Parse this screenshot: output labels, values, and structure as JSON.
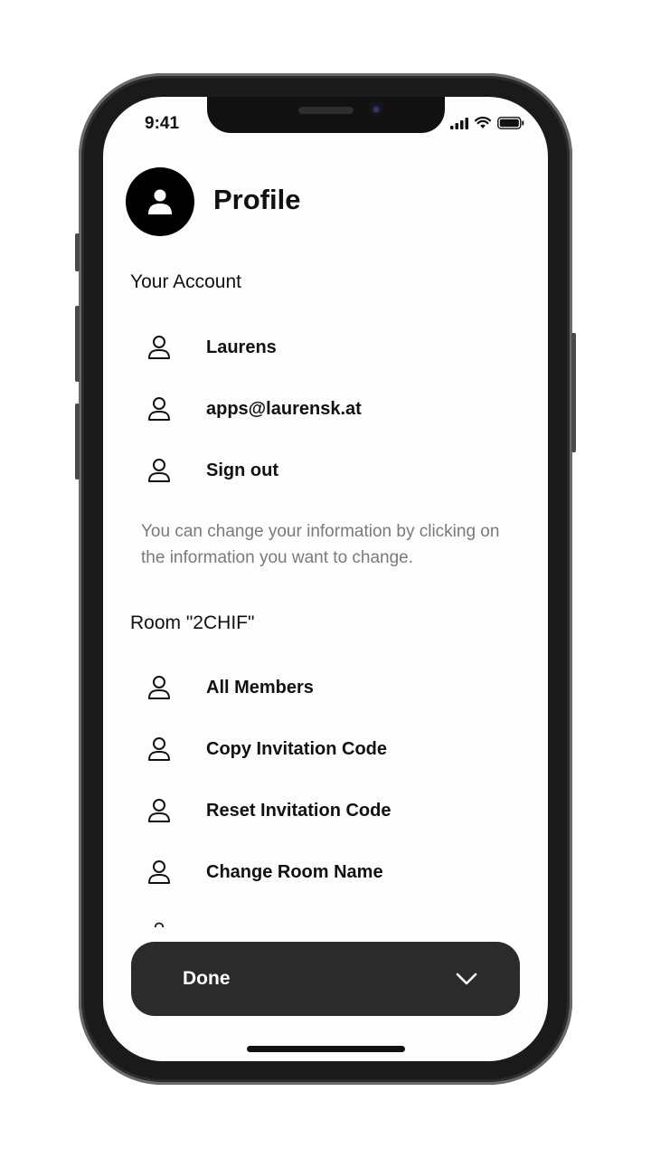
{
  "status_bar": {
    "time": "9:41"
  },
  "header": {
    "title": "Profile",
    "avatar_icon": "person-icon"
  },
  "account_section": {
    "title": "Your Account",
    "items": [
      {
        "label": "Laurens",
        "icon": "person-outline-icon"
      },
      {
        "label": "apps@laurensk.at",
        "icon": "person-outline-icon"
      },
      {
        "label": "Sign out",
        "icon": "person-outline-icon"
      }
    ],
    "hint": "You can change your information by clicking on the information you want to change."
  },
  "room_section": {
    "title": "Room \"2CHIF\"",
    "items": [
      {
        "label": "All Members",
        "icon": "person-outline-icon"
      },
      {
        "label": "Copy Invitation Code",
        "icon": "person-outline-icon"
      },
      {
        "label": "Reset Invitation Code",
        "icon": "person-outline-icon"
      },
      {
        "label": "Change Room Name",
        "icon": "person-outline-icon"
      }
    ]
  },
  "done_bar": {
    "label": "Done",
    "icon": "chevron-down-icon"
  },
  "colors": {
    "accent_dark": "#2b2b2b",
    "text": "#111111",
    "hint_text": "#7a7a7a",
    "background": "#fdfdfd"
  }
}
